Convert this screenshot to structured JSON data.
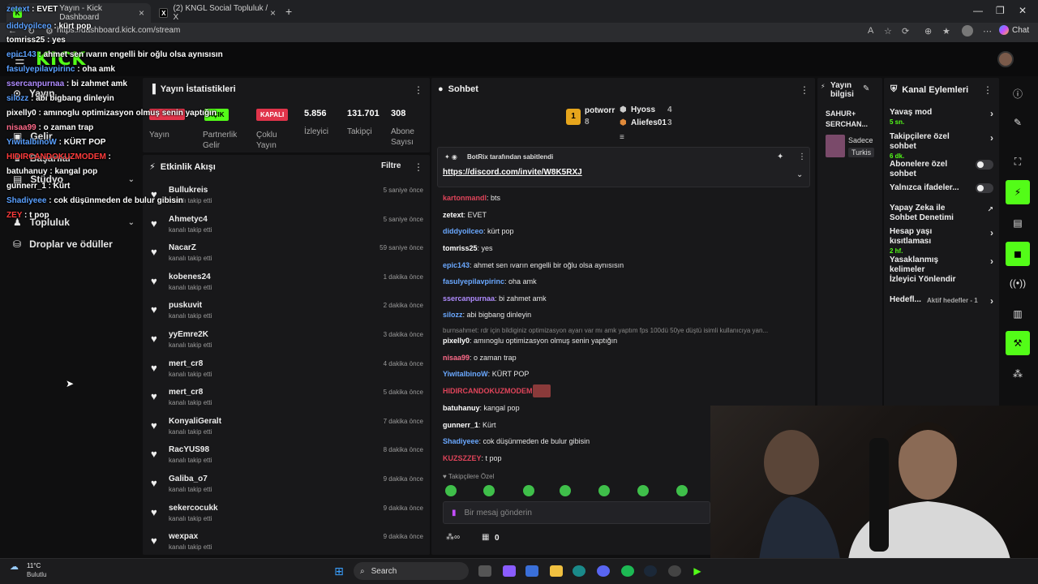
{
  "browser": {
    "tabs": [
      {
        "title": "Yayın - Kick Dashboard",
        "icon": "kick-icon"
      },
      {
        "title": "(2) KNGL Social Topluluk / X",
        "icon": "x-icon"
      }
    ],
    "url": "https://dashboard.kick.com/stream",
    "chat_button": "Chat"
  },
  "kick": {
    "logo": "KICK"
  },
  "sidebar": [
    {
      "label": "Yayın",
      "icon": "stream-icon"
    },
    {
      "label": "Gelir",
      "icon": "income-icon"
    },
    {
      "label": "Stüdyo",
      "icon": "studio-icon"
    },
    {
      "label": "Başarılar",
      "icon": "achievements-icon"
    },
    {
      "label": "Topluluk",
      "icon": "community-icon"
    },
    {
      "label": "Droplar ve ödüller",
      "icon": "drops-icon"
    }
  ],
  "overlay_chat": [
    {
      "user": "zetext",
      "msg": "EVET",
      "color": "#5aa0ff"
    },
    {
      "user": "diddyoilceo",
      "msg": "kürt pop",
      "color": "#5aa0ff"
    },
    {
      "user": "tomriss25",
      "msg": "yes",
      "color": "#ffffff"
    },
    {
      "user": "epic143",
      "msg": "ahmet sen ıvarın engelli bir oğlu olsa aynısısın",
      "color": "#5aa0ff"
    },
    {
      "user": "fasulyepilavpirinc",
      "msg": "oha amk",
      "color": "#5aa0ff"
    },
    {
      "user": "ssercanpurnaa",
      "msg": "bi zahmet amk",
      "color": "#b08cff"
    },
    {
      "user": "silozz",
      "msg": "abi bigbang dinleyin",
      "color": "#5aa0ff"
    },
    {
      "user": "pixelly0",
      "msg": "amınoglu optimizasyon olmuş senin yaptığın",
      "color": "#ffffff"
    },
    {
      "user": "nisaa99",
      "msg": "o zaman trap",
      "color": "#ff6b8a"
    },
    {
      "user": "YiwitalbinoW",
      "msg": "KÜRT POP",
      "color": "#5aa0ff"
    },
    {
      "user": "HIDIRCANDOKUZMODEM",
      "msg": "",
      "color": "#ff3b3b"
    },
    {
      "user": "batuhanuy",
      "msg": "kangal pop",
      "color": "#ffffff"
    },
    {
      "user": "gunnerr_1",
      "msg": "Kürt",
      "color": "#ffffff"
    },
    {
      "user": "Shadiyeee",
      "msg": "cok düşünmeden de bulur gibisin",
      "color": "#5aa0ff"
    },
    {
      "user": "ZEY",
      "msg": "t pop",
      "color": "#ff3b3b"
    }
  ],
  "stats": {
    "title": "Yayın İstatistikleri",
    "badges": {
      "acik": "AÇIK",
      "kapali": "KAPALI"
    },
    "items": [
      {
        "label": "Yayın",
        "value": ""
      },
      {
        "label": "Partnerlik Gelir",
        "value": ""
      },
      {
        "label": "Çoklu Yayın",
        "value": ""
      },
      {
        "label": "İzleyici",
        "value": "5.856"
      },
      {
        "label": "Takipçi",
        "value": "131.701"
      },
      {
        "label": "Abone Sayısı",
        "value": "308"
      }
    ]
  },
  "feed": {
    "title": "Etkinlik Akışı",
    "filter": "Filtre",
    "sub": "kanalı takip etti",
    "items": [
      {
        "name": "Bullukreis",
        "time": "5 saniye önce"
      },
      {
        "name": "Ahmetyc4",
        "time": "5 saniye önce"
      },
      {
        "name": "NacarZ",
        "time": "59 saniye önce"
      },
      {
        "name": "kobenes24",
        "time": "1 dakika önce"
      },
      {
        "name": "puskuvit",
        "time": "2 dakika önce"
      },
      {
        "name": "yyEmre2K",
        "time": "3 dakika önce"
      },
      {
        "name": "mert_cr8",
        "time": "4 dakika önce"
      },
      {
        "name": "mert_cr8",
        "time": "5 dakika önce"
      },
      {
        "name": "KonyaliGeralt",
        "time": "7 dakika önce"
      },
      {
        "name": "RacYUS98",
        "time": "8 dakika önce"
      },
      {
        "name": "Galiba_o7",
        "time": "9 dakika önce"
      },
      {
        "name": "sekercocukk",
        "time": "9 dakika önce"
      },
      {
        "name": "wexpax",
        "time": "9 dakika önce"
      }
    ]
  },
  "chat": {
    "title": "Sohbet",
    "podium": [
      {
        "rank": "1",
        "name": "potworr",
        "count": "8"
      },
      {
        "rank": "",
        "name": "Hyoss",
        "count": "4"
      },
      {
        "rank": "",
        "name": "Aliefes01",
        "count": "3"
      }
    ],
    "pinned_by": "BotRix tarafından sabitlendi",
    "pinned_link": "https://discord.com/invite/W8K5RXJ",
    "messages": [
      {
        "user": "kartonmandl",
        "msg": "bts",
        "color": "#e0445a"
      },
      {
        "user": "zetext",
        "msg": "EVET",
        "color": "#ffffff"
      },
      {
        "user": "diddyoilceo",
        "msg": "kürt pop",
        "color": "#6aa8ff"
      },
      {
        "user": "tomriss25",
        "msg": "yes",
        "color": "#ffffff"
      },
      {
        "user": "epic143",
        "msg": "ahmet sen ıvarın engelli bir oğlu olsa aynısısın",
        "color": "#6aa8ff"
      },
      {
        "user": "fasulyepilavpirinc",
        "msg": "oha amk",
        "color": "#6aa8ff"
      },
      {
        "user": "ssercanpurnaa",
        "msg": "bi zahmet amk",
        "color": "#b08cff"
      },
      {
        "user": "silozz",
        "msg": "abi bigbang dinleyin",
        "color": "#6aa8ff"
      },
      {
        "user": "pixelly0",
        "msg": "amınoglu optimizasyon olmuş senin yaptığın",
        "color": "#ffffff"
      },
      {
        "user": "nisaa99",
        "msg": "o zaman trap",
        "color": "#ff6b8a"
      },
      {
        "user": "YiwitalbinoW",
        "msg": "KÜRT POP",
        "color": "#6aa8ff"
      },
      {
        "user": "HIDIRCANDOKUZMODEM",
        "msg": "",
        "color": "#e0445a"
      },
      {
        "user": "batuhanuy",
        "msg": "kangal pop",
        "color": "#ffffff"
      },
      {
        "user": "gunnerr_1",
        "msg": "Kürt",
        "color": "#ffffff"
      },
      {
        "user": "Shadiyeee",
        "msg": "cok düşünmeden de bulur gibisin",
        "color": "#6aa8ff"
      },
      {
        "user": "KUZSZZEY",
        "msg": "t pop",
        "color": "#e0445a"
      }
    ],
    "reply_note": "burnsahmet: rdr için bildiginiz optimizasyon ayarı var mı amk yaptım fps 100dü 50ye düştü isimli kullanıcıya yan...",
    "followers_only": "Takipçilere Özel",
    "input_placeholder": "Bir mesaj gönderin",
    "bottom_count": "0"
  },
  "stream_info": {
    "title": "Yayın bilgisi",
    "stream_title": "SAHUR+ SERCHAN...",
    "category": "Sadece",
    "tag": "Turkis"
  },
  "actions": {
    "title": "Kanal Eylemleri",
    "items": [
      {
        "label": "Yavaş mod",
        "sub": "5 sn.",
        "type": "arrow"
      },
      {
        "label": "Takipçilere özel sohbet",
        "sub": "6 dk.",
        "type": "arrow"
      },
      {
        "label": "Abonelere özel sohbet",
        "sub": "",
        "type": "toggle"
      },
      {
        "label": "Yalnızca ifadeler...",
        "sub": "",
        "type": "toggle"
      },
      {
        "label": "Yapay Zeka ile Sohbet Denetimi",
        "sub": "",
        "type": "external"
      },
      {
        "label": "Hesap yaşı kısıtlaması",
        "sub": "2 hf.",
        "type": "arrow"
      },
      {
        "label": "Yasaklanmış kelimeler",
        "sub": "",
        "type": "arrow"
      },
      {
        "label": "İzleyici Yönlendir",
        "sub": "",
        "type": "none"
      },
      {
        "label": "Hedefl...",
        "sub": "Aktif hedefler - 1",
        "type": "arrow"
      }
    ]
  },
  "taskbar": {
    "weather_temp": "11°C",
    "weather_desc": "Bulutlu",
    "search": "Search"
  },
  "colors": {
    "accent": "#53fc18",
    "danger": "#e0344a"
  }
}
